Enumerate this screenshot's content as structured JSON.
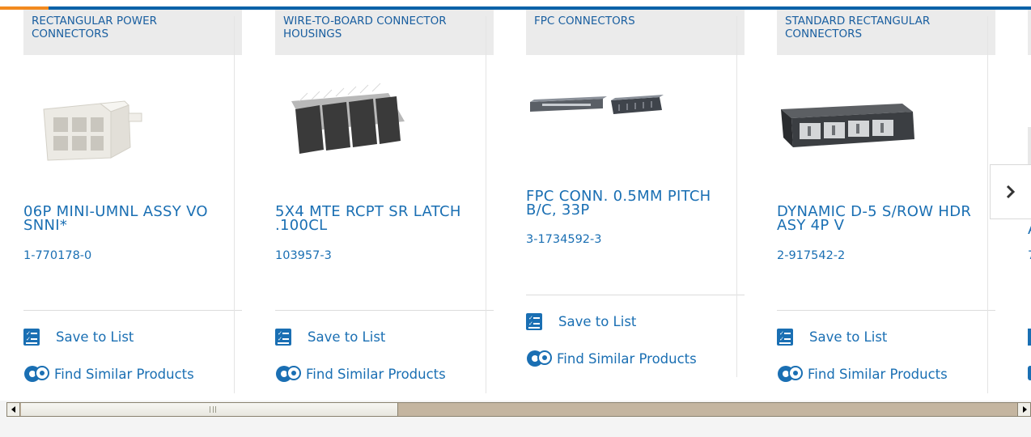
{
  "colors": {
    "accent": "#f28a1f",
    "brand_blue": "#0a62a8",
    "link_blue": "#1a6fb3"
  },
  "products": [
    {
      "category": "RECTANGULAR POWER CONNECTORS",
      "title": "06P MINI-UMNL ASSY VO SNNI*",
      "part_number": "1-770178-0",
      "save_label": "Save to List",
      "similar_label": "Find Similar Products"
    },
    {
      "category": "WIRE-TO-BOARD CONNECTOR HOUSINGS",
      "title": "5X4 MTE RCPT SR LATCH .100CL",
      "part_number": "103957-3",
      "save_label": "Save to List",
      "similar_label": "Find Similar Products"
    },
    {
      "category": "FPC CONNECTORS",
      "title": "FPC CONN. 0.5MM PITCH B/C, 33P",
      "part_number": "3-1734592-3",
      "save_label": "Save to List",
      "similar_label": "Find Similar Products"
    },
    {
      "category": "STANDARD RECTANGULAR CONNECTORS",
      "title": "DYNAMIC D-5 S/ROW HDR ASY 4P V",
      "part_number": "2-917542-2",
      "save_label": "Save to List",
      "similar_label": "Find Similar Products"
    }
  ],
  "partial_card": {
    "title_fragment": "A",
    "part_fragment": "7"
  },
  "carousel": {
    "next_icon": "chevron-right-icon"
  },
  "scrollbar": {
    "left_icon": "arrow-left-icon",
    "right_icon": "arrow-right-icon"
  }
}
